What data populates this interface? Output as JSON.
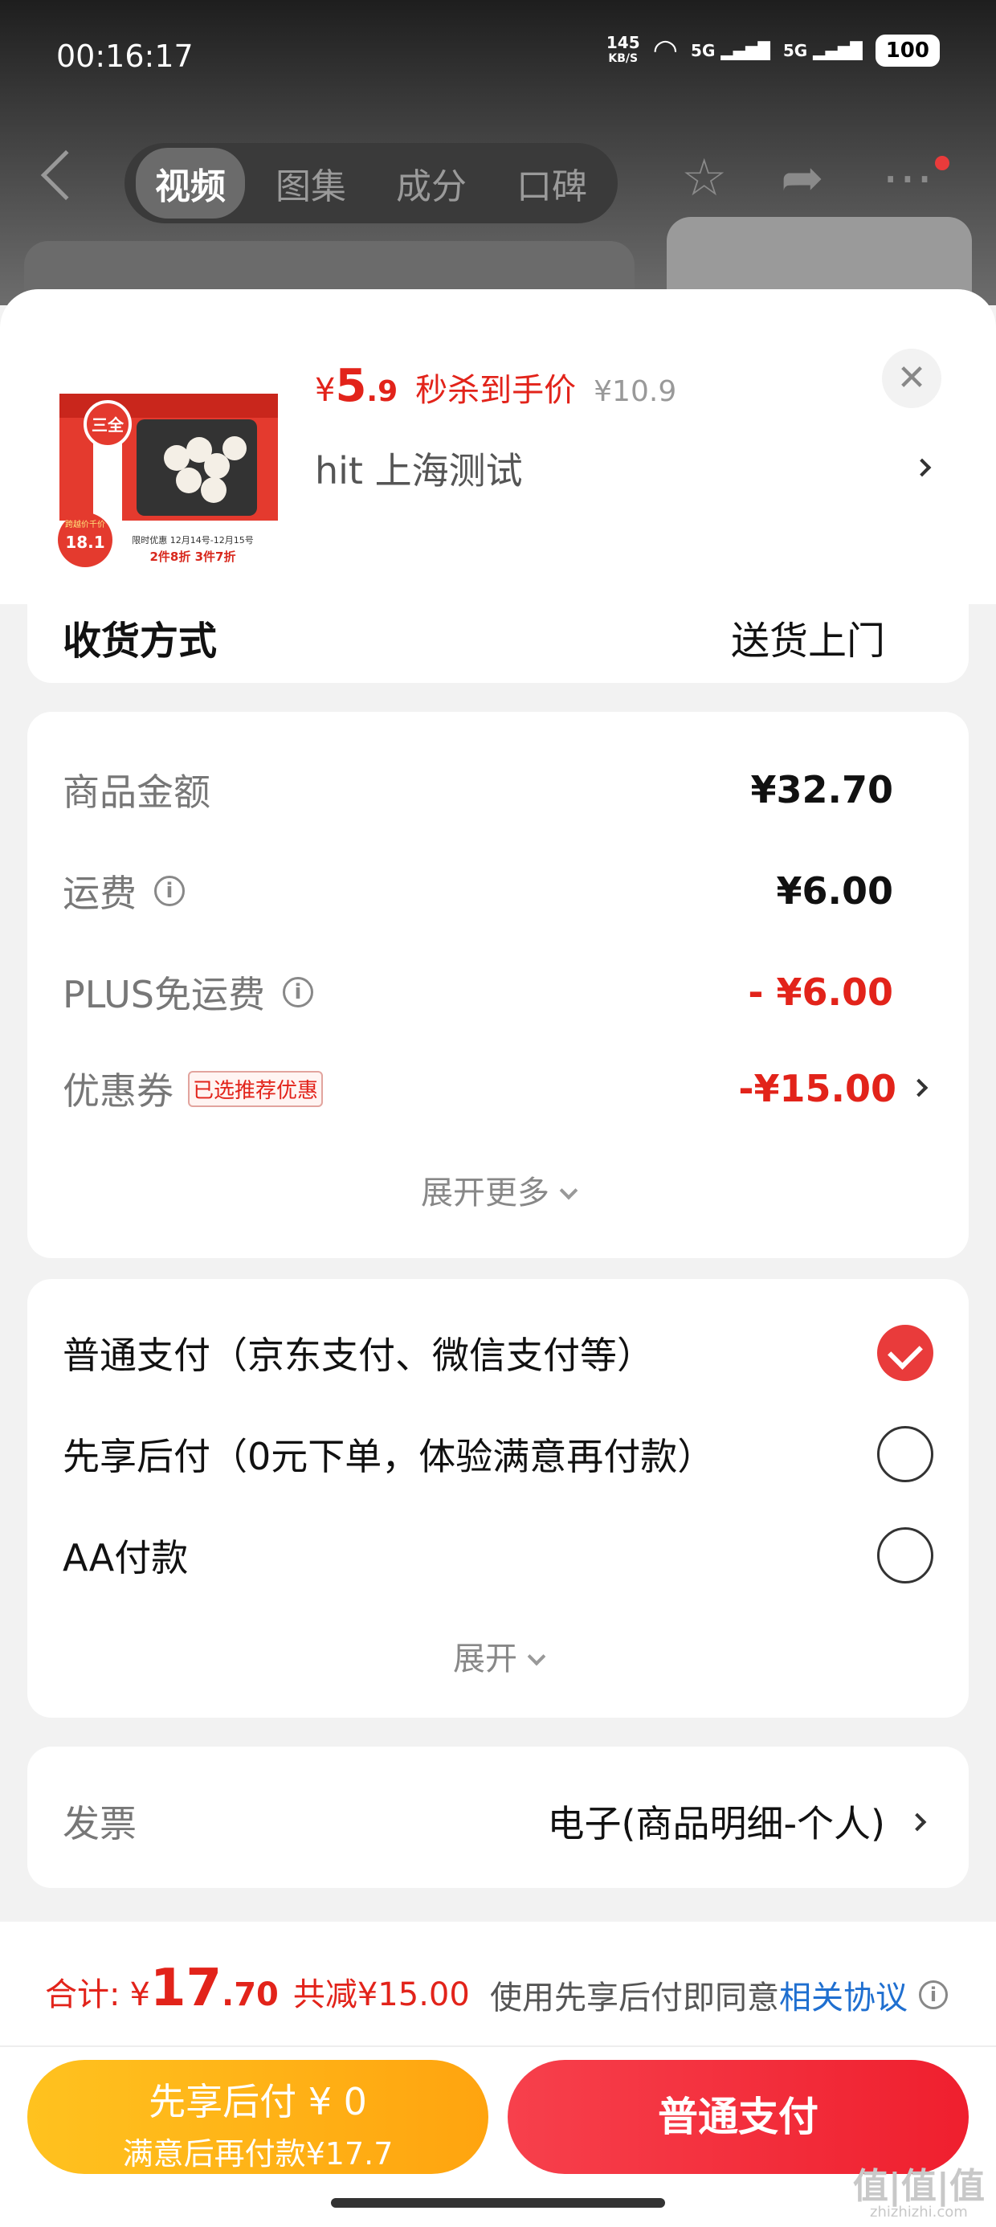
{
  "status_bar": {
    "time": "00:16:17",
    "speed_value": "145",
    "speed_unit": "KB/S",
    "sig1": "5G",
    "sig2": "5G",
    "battery": "100"
  },
  "nav": {
    "tabs": [
      "视频",
      "图集",
      "成分",
      "口碑"
    ],
    "active_tab": 0
  },
  "product": {
    "price_currency": "¥",
    "price_int": "5",
    "price_dec": ".9",
    "price_tag": "秒杀到手价",
    "original_price": "¥10.9",
    "shop": "hit  上海测试",
    "image_labels": {
      "brand": "三全",
      "badge_top": "跨越价千价",
      "badge_value": "18.1",
      "promo_line1": "限时优惠  12月14号-12月15号",
      "promo_line2": "2件8折  3件7折"
    }
  },
  "delivery": {
    "label": "收货方式",
    "value": "送货上门"
  },
  "amounts": {
    "rows": [
      {
        "label": "商品金额",
        "value": "¥32.70"
      },
      {
        "label": "运费",
        "value": "¥6.00"
      },
      {
        "label": "PLUS免运费",
        "value": "- ¥6.00"
      },
      {
        "label": "优惠券",
        "badge": "已选推荐优惠",
        "value": "-¥15.00"
      }
    ],
    "expand_label": "展开更多"
  },
  "payment": {
    "options": [
      {
        "label": "普通支付（京东支付、微信支付等）",
        "selected": true
      },
      {
        "label": "先享后付（0元下单，体验满意再付款）",
        "selected": false
      },
      {
        "label": "AA付款",
        "selected": false
      }
    ],
    "expand_label": "展开"
  },
  "invoice": {
    "label": "发票",
    "value": "电子(商品明细-个人)"
  },
  "footer": {
    "total_label": "合计:",
    "total_currency": "¥",
    "total_int": "17",
    "total_dec": ".70",
    "saved": "共减¥15.00",
    "agree_text": "使用先享后付即同意",
    "agree_link": "相关协议",
    "btn_later_line1": "先享后付 ¥ 0",
    "btn_later_line2": "满意后再付款¥17.7",
    "btn_pay": "普通支付"
  },
  "watermark": {
    "main": "值|值|值",
    "sub": "zhizhizhi.com"
  },
  "colors": {
    "accent_red": "#e2231a",
    "pay_button": "#ef1f2e",
    "later_button": "#ffb016",
    "link_blue": "#1f6fd0"
  }
}
